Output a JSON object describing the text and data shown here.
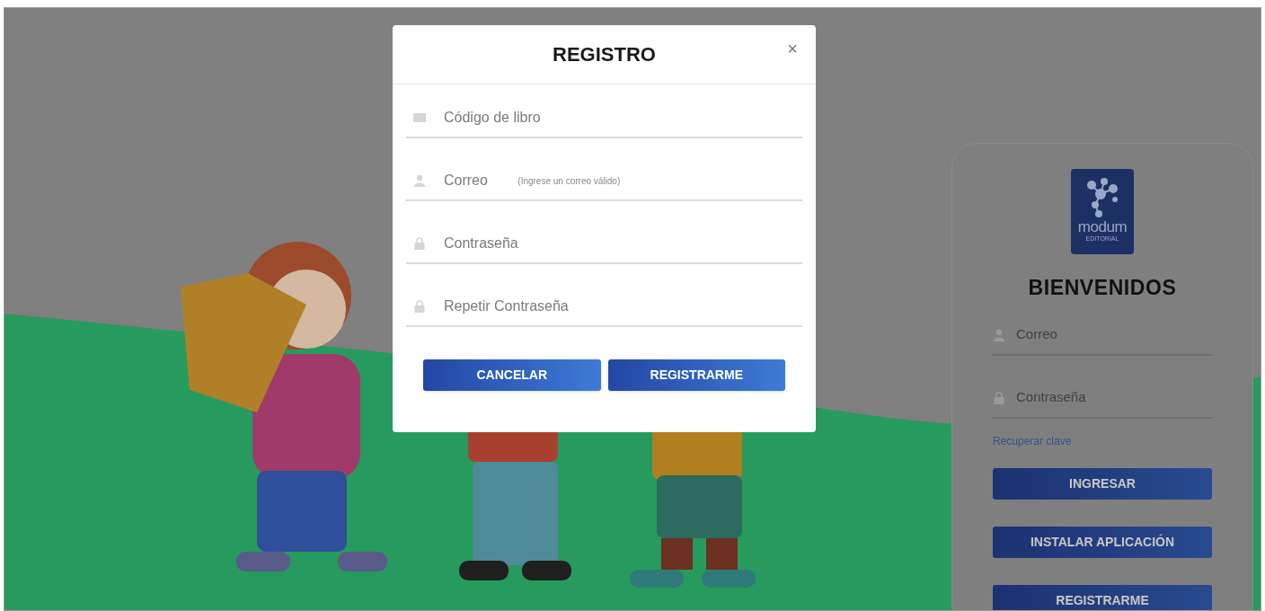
{
  "modal": {
    "title": "REGISTRO",
    "close": "×",
    "fields": [
      {
        "kind": "book",
        "placeholder": "Código de libro"
      },
      {
        "kind": "user",
        "placeholder": "Correo",
        "hint": "(Ingrese un correo válido)"
      },
      {
        "kind": "lock",
        "placeholder": "Contraseña"
      },
      {
        "kind": "lock",
        "placeholder": "Repetir Contraseña"
      }
    ],
    "buttons": [
      "CANCELAR",
      "REGISTRARME"
    ]
  },
  "login": {
    "logo": {
      "name": "modum",
      "subtitle": "EDITORIAL"
    },
    "title": "BIENVENIDOS",
    "fields": [
      {
        "kind": "user",
        "placeholder": "Correo"
      },
      {
        "kind": "lock",
        "placeholder": "Contraseña"
      }
    ],
    "recover_link": "Recuperar clave",
    "buttons": [
      "INGRESAR",
      "INSTALAR APLICACIÓN",
      "REGISTRARME"
    ]
  }
}
